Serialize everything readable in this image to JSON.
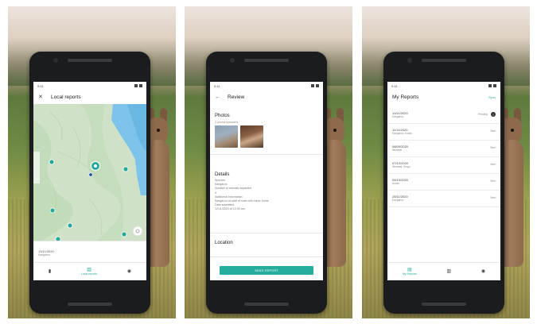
{
  "screens": [
    {
      "status_time": "9:41",
      "title": "Local reports",
      "back_icon": "close-icon",
      "footer_date": "13/11/2020",
      "footer_sub": "Kangaroo",
      "nav": [
        {
          "icon": "book-icon",
          "label": ""
        },
        {
          "icon": "map-icon",
          "label": "Local reports"
        },
        {
          "icon": "user-icon",
          "label": ""
        }
      ]
    },
    {
      "status_time": "9:41",
      "title": "Review",
      "back_icon": "arrow-back-icon",
      "photos_heading": "Photos",
      "photos_sub": "2 photos uploaded",
      "details_heading": "Details",
      "details_lines": [
        "Species",
        "Kangaroo",
        "Number of animals impacted",
        "4",
        "Additional information",
        "Kangaroo on side of road with minor burns",
        "Date submitted",
        "12/11/2020 at 10:30 am"
      ],
      "location_heading": "Location",
      "send_label": "SEND REPORT"
    },
    {
      "status_time": "9:41",
      "title": "My Reports",
      "action": "Sync",
      "reports": [
        {
          "date": "13/11/2020",
          "species": "Kangaroo",
          "status": "Pending",
          "pending": true
        },
        {
          "date": "11/11/2020",
          "species": "Kangaroo, Koala",
          "status": "Sent",
          "pending": false
        },
        {
          "date": "08/09/2020",
          "species": "Wombat",
          "status": "Sent",
          "pending": false
        },
        {
          "date": "07/12/2020",
          "species": "Wombat, Dingo",
          "status": "Sent",
          "pending": false
        },
        {
          "date": "04/10/2020",
          "species": "Koala",
          "status": "Sent",
          "pending": false
        },
        {
          "date": "28/11/2020",
          "species": "Kangaroo",
          "status": "Sent",
          "pending": false
        }
      ],
      "nav": [
        {
          "icon": "reports-icon",
          "label": "My Reports"
        },
        {
          "icon": "map-icon",
          "label": ""
        },
        {
          "icon": "user-icon",
          "label": ""
        }
      ]
    }
  ],
  "colors": {
    "accent": "#25a99a",
    "map_land": "#cfe2c8",
    "map_water": "#7ec3ea",
    "phone": "#1b1c1e"
  }
}
